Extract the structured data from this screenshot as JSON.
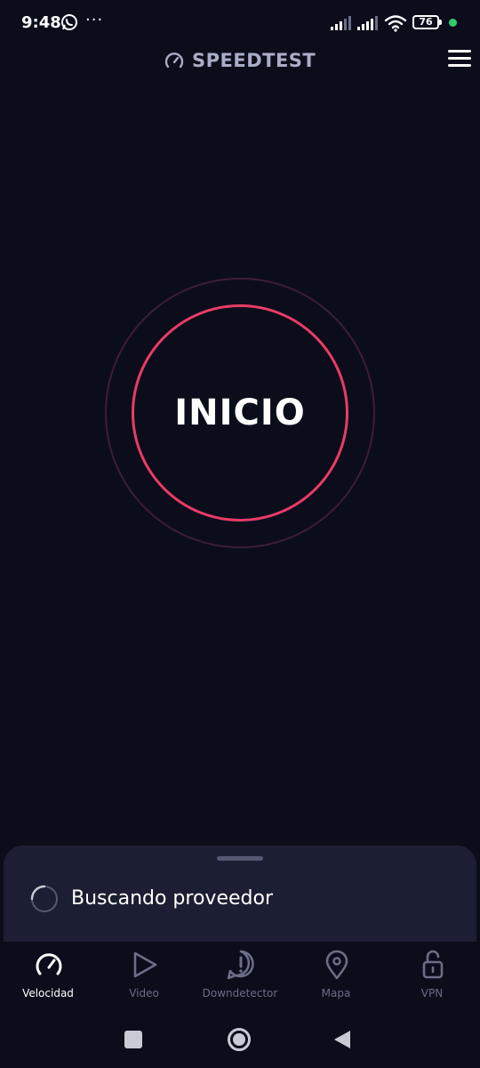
{
  "status_bar": {
    "time": "9:48",
    "more": "···",
    "battery": "76",
    "icons": [
      "whatsapp-icon",
      "signal-icon",
      "signal-icon",
      "wifi-icon",
      "battery-icon"
    ]
  },
  "header": {
    "title": "SPEEDTEST",
    "brand_icon": "speedometer-icon",
    "menu_icon": "hamburger-menu-icon"
  },
  "start": {
    "label": "INICIO"
  },
  "provider_panel": {
    "status": "Buscando proveedor"
  },
  "bottom_nav": {
    "items": [
      {
        "label": "Velocidad",
        "icon": "speedometer-icon",
        "active": true
      },
      {
        "label": "Video",
        "icon": "play-icon",
        "active": false
      },
      {
        "label": "Downdetector",
        "icon": "alert-icon",
        "active": false
      },
      {
        "label": "Mapa",
        "icon": "map-pin-icon",
        "active": false
      },
      {
        "label": "VPN",
        "icon": "unlock-icon",
        "active": false
      }
    ]
  },
  "colors": {
    "background": "#0b0d1b",
    "accent": "#ea3b66",
    "panel": "#1c1f33",
    "inactive": "#6a6e86"
  }
}
